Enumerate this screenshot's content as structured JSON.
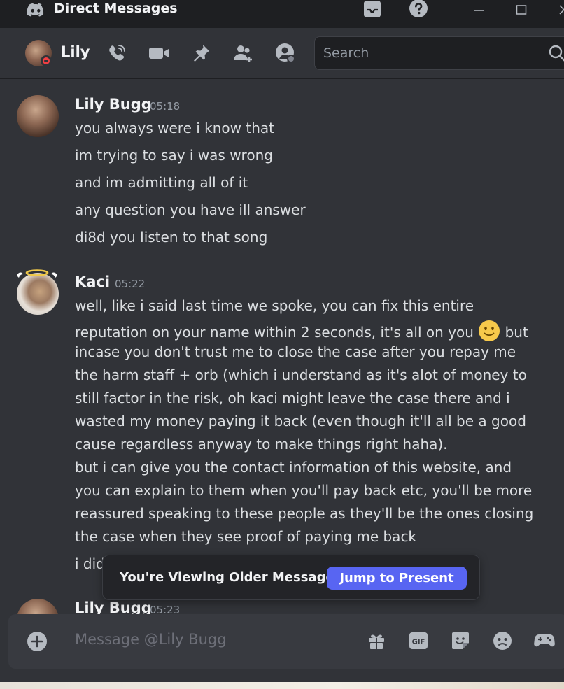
{
  "titlebar": {
    "title": "Direct Messages",
    "icons": [
      "discord-logo",
      "inbox-icon",
      "help-icon"
    ],
    "window_controls": [
      "minimize",
      "maximize",
      "close"
    ]
  },
  "header": {
    "name": "Lily",
    "status": "do-not-disturb",
    "icons": [
      "call-icon",
      "video-icon",
      "pin-icon",
      "add-user-icon",
      "user-profile-icon"
    ],
    "search": {
      "placeholder": "Search"
    }
  },
  "messages": [
    {
      "author": "Lily Bugg",
      "time": "05:18",
      "lines": [
        "you always were i know that",
        "im trying to say i was wrong",
        "and im admitting all of it",
        "any question you have ill answer",
        "di8d you listen to that song"
      ]
    },
    {
      "author": "Kaci",
      "time": "05:22",
      "lines": [
        "well, like i said last time we spoke, you can fix this entire",
        "reputation on your name within 2 seconds, it's all on you",
        "but",
        "incase you don't trust me to close the case after you repay me",
        "the harm staff + orb (which i understand as it's alot of money to",
        "still factor in the risk, oh kaci might leave the case there and i",
        "wasted my money paying it back (even though it'll all be a good",
        "cause regardless anyway to make things right haha).",
        "but i can give you the contact information of this website, and",
        "you can explain to them when you'll pay back etc, you'll be more",
        "reassured speaking to these people as they'll be the ones closing",
        "the case when they see proof of paying me back",
        "i did"
      ]
    },
    {
      "author": "Lily Bugg",
      "time": "05:23",
      "lines": []
    }
  ],
  "older_bar": {
    "text": "You're Viewing Older Messages",
    "button": "Jump to Present"
  },
  "composer": {
    "placeholder": "Message @Lily Bugg",
    "icons": [
      "gift-icon",
      "gif-icon",
      "sticker-icon",
      "emoji-icon",
      "activities-icon"
    ]
  },
  "colors": {
    "background": "#313338",
    "titlebar": "#1e1f22",
    "accent": "#5865f2",
    "dnd": "#f23f43"
  }
}
